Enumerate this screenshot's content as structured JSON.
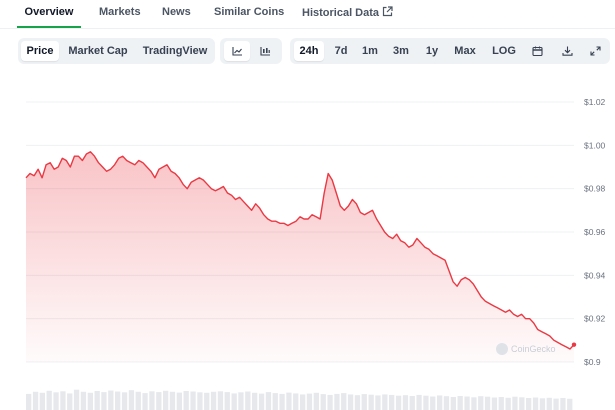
{
  "top_tabs": [
    {
      "label": "Overview",
      "active": true
    },
    {
      "label": "Markets",
      "active": false
    },
    {
      "label": "News",
      "active": false
    },
    {
      "label": "Similar Coins",
      "active": false
    },
    {
      "label": "Historical Data",
      "active": false,
      "icon": "external-link-icon"
    }
  ],
  "toolbar": {
    "view_tabs": [
      {
        "label": "Price",
        "active": true
      },
      {
        "label": "Market Cap",
        "active": false
      },
      {
        "label": "TradingView",
        "active": false
      }
    ],
    "chart_type_icons": [
      {
        "icon": "line-chart-icon",
        "active": true
      },
      {
        "icon": "candlestick-chart-icon",
        "active": false
      }
    ],
    "ranges": [
      {
        "label": "24h",
        "active": true
      },
      {
        "label": "7d",
        "active": false
      },
      {
        "label": "1m",
        "active": false
      },
      {
        "label": "3m",
        "active": false
      },
      {
        "label": "1y",
        "active": false
      },
      {
        "label": "Max",
        "active": false
      },
      {
        "label": "LOG",
        "active": false
      }
    ],
    "action_icons": [
      "calendar-icon",
      "download-icon",
      "expand-icon"
    ]
  },
  "colors": {
    "line": "#ea3943",
    "fill": "#ea3943",
    "accent": "#16a34a",
    "grid": "#eef0f3",
    "volume": "#e6e8ec"
  },
  "watermark": "CoinGecko",
  "chart_data": {
    "type": "area",
    "y_tick_labels": [
      "$1.02",
      "$1.00",
      "$0.98",
      "$0.96",
      "$0.94",
      "$0.92",
      "$0.9"
    ],
    "y_ticks": [
      1.02,
      1.0,
      0.98,
      0.96,
      0.94,
      0.92,
      0.9
    ],
    "ylim": [
      0.9,
      1.02
    ],
    "grid": true,
    "series": [
      {
        "values": [
          0.985,
          0.987,
          0.986,
          0.989,
          0.985,
          0.991,
          0.992,
          0.989,
          0.99,
          0.994,
          0.993,
          0.99,
          0.995,
          0.995,
          0.993,
          0.996,
          0.997,
          0.995,
          0.992,
          0.99,
          0.988,
          0.989,
          0.991,
          0.994,
          0.995,
          0.993,
          0.992,
          0.991,
          0.993,
          0.992,
          0.99,
          0.988,
          0.985,
          0.989,
          0.99,
          0.991,
          0.988,
          0.987,
          0.985,
          0.982,
          0.98,
          0.983,
          0.984,
          0.985,
          0.984,
          0.982,
          0.98,
          0.979,
          0.98,
          0.981,
          0.978,
          0.977,
          0.975,
          0.976,
          0.974,
          0.972,
          0.97,
          0.973,
          0.971,
          0.968,
          0.966,
          0.965,
          0.965,
          0.964,
          0.964,
          0.963,
          0.964,
          0.965,
          0.967,
          0.966,
          0.966,
          0.968,
          0.967,
          0.966,
          0.978,
          0.987,
          0.984,
          0.978,
          0.972,
          0.97,
          0.972,
          0.975,
          0.973,
          0.969,
          0.968,
          0.969,
          0.97,
          0.966,
          0.963,
          0.96,
          0.958,
          0.957,
          0.959,
          0.956,
          0.955,
          0.953,
          0.954,
          0.957,
          0.955,
          0.953,
          0.952,
          0.95,
          0.949,
          0.948,
          0.947,
          0.942,
          0.937,
          0.935,
          0.938,
          0.939,
          0.938,
          0.936,
          0.933,
          0.93,
          0.928,
          0.927,
          0.926,
          0.925,
          0.924,
          0.923,
          0.924,
          0.922,
          0.921,
          0.922,
          0.92,
          0.92,
          0.918,
          0.915,
          0.914,
          0.913,
          0.912,
          0.91,
          0.909,
          0.908,
          0.907,
          0.906,
          0.908
        ]
      }
    ],
    "volume": [
      0.62,
      0.7,
      0.66,
      0.74,
      0.68,
      0.72,
      0.64,
      0.78,
      0.7,
      0.66,
      0.73,
      0.69,
      0.75,
      0.71,
      0.68,
      0.76,
      0.7,
      0.65,
      0.72,
      0.69,
      0.74,
      0.7,
      0.67,
      0.73,
      0.71,
      0.68,
      0.66,
      0.7,
      0.72,
      0.69,
      0.64,
      0.68,
      0.71,
      0.66,
      0.63,
      0.69,
      0.65,
      0.62,
      0.67,
      0.64,
      0.6,
      0.63,
      0.66,
      0.61,
      0.58,
      0.62,
      0.65,
      0.6,
      0.57,
      0.61,
      0.59,
      0.56,
      0.6,
      0.58,
      0.55,
      0.57,
      0.54,
      0.58,
      0.55,
      0.52,
      0.56,
      0.53,
      0.5,
      0.54,
      0.52,
      0.49,
      0.53,
      0.51,
      0.48,
      0.5,
      0.47,
      0.51,
      0.49,
      0.46,
      0.48,
      0.45,
      0.47,
      0.44,
      0.46,
      0.43
    ]
  }
}
